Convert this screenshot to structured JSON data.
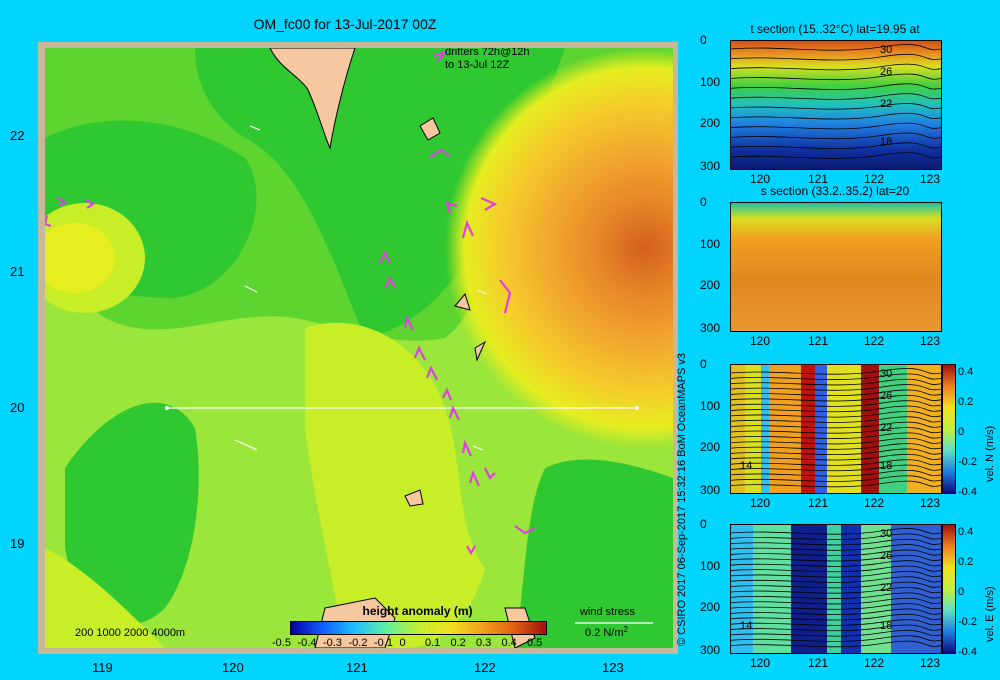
{
  "title": "OM_fc00 for 13-Jul-2017 00Z",
  "map": {
    "drifters_line1": "drifters 72h@12h",
    "drifters_line2": "to 13-Jul 12Z",
    "lat_ticks": [
      "22",
      "21",
      "20",
      "19"
    ],
    "lon_ticks": [
      "119",
      "120",
      "121",
      "122",
      "123"
    ],
    "depth_legend": "200  1000  2000  4000m",
    "wind_stress_label": "wind stress",
    "wind_stress_value": "0.2 N/m",
    "wind_stress_exp": "2",
    "colorbar": {
      "title": "height anomaly  (m)",
      "ticks": [
        "-0.5",
        "-0.4",
        "-0.3",
        "-0.2",
        "-0.1",
        "0",
        "0.1",
        "0.2",
        "0.3",
        "0.4",
        "0.5"
      ]
    },
    "colors": {
      "land": "#f5c8a0",
      "frame": "#c8b89a",
      "drifter": "#e040e0"
    }
  },
  "copyright": "© CSIRO 2017   06-Sep-2017 15:32:16 BoM OceanMAPS v3",
  "panels": [
    {
      "title": "t section (15..32°C) lat=19.95 at",
      "y_ticks": [
        "0",
        "100",
        "200",
        "300"
      ],
      "x_ticks": [
        "120",
        "121",
        "122",
        "123"
      ],
      "contour_labels": [
        "30",
        "26",
        "22",
        "18"
      ]
    },
    {
      "title": "s section (33.2..35.2) lat=20",
      "y_ticks": [
        "0",
        "100",
        "200",
        "300"
      ],
      "x_ticks": [
        "120",
        "121",
        "122",
        "123"
      ]
    },
    {
      "title": "",
      "y_ticks": [
        "0",
        "100",
        "200",
        "300"
      ],
      "x_ticks": [
        "120",
        "121",
        "122",
        "123"
      ],
      "contour_labels": [
        "30",
        "26",
        "22",
        "18",
        "14"
      ],
      "cb_ticks": [
        "0.4",
        "0.2",
        "0",
        "-0.2",
        "-0.4"
      ],
      "cb_label": "vel. N  (m/s)"
    },
    {
      "title": "",
      "y_ticks": [
        "0",
        "100",
        "200",
        "300"
      ],
      "x_ticks": [
        "120",
        "121",
        "122",
        "123"
      ],
      "contour_labels": [
        "30",
        "26",
        "22",
        "18",
        "14"
      ],
      "cb_ticks": [
        "0.4",
        "0.2",
        "0",
        "-0.2",
        "-0.4"
      ],
      "cb_label": "vel. E  (m/s)"
    }
  ]
}
